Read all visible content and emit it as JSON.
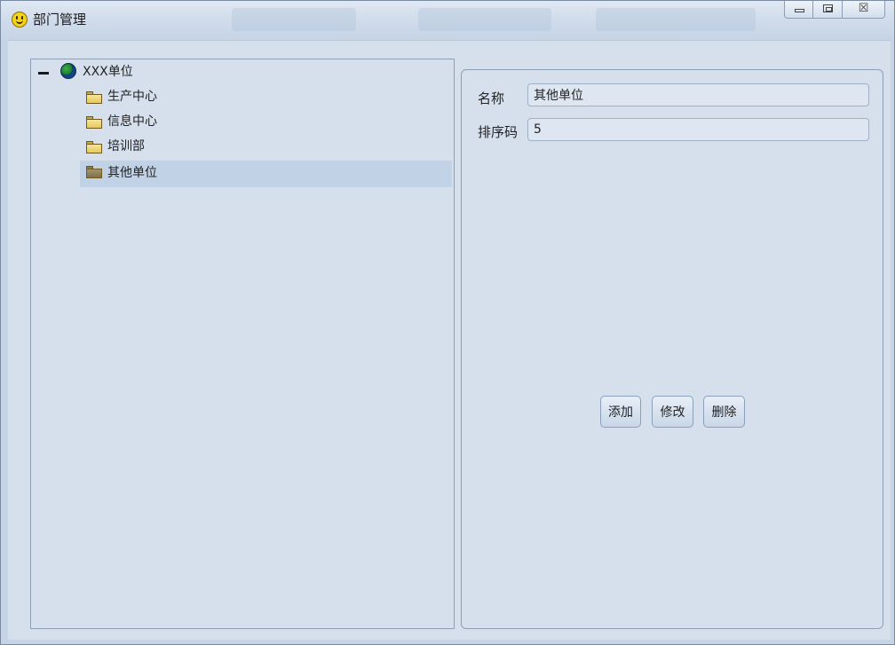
{
  "window": {
    "title": "部门管理",
    "controls": {
      "minimize_icon": "minimize-icon",
      "maximize_icon": "maximize-icon",
      "close_glyph": "☒"
    }
  },
  "tree": {
    "root": {
      "label": "XXX单位",
      "icon": "globe-icon",
      "expanded": true
    },
    "children": [
      {
        "label": "生产中心",
        "icon": "folder-icon",
        "selected": false
      },
      {
        "label": "信息中心",
        "icon": "folder-icon",
        "selected": false
      },
      {
        "label": "培训部",
        "icon": "folder-icon",
        "selected": false
      },
      {
        "label": "其他单位",
        "icon": "folder-icon",
        "selected": true
      }
    ]
  },
  "form": {
    "name_label": "名称",
    "name_value": "其他单位",
    "sort_label": "排序码",
    "sort_value": "5",
    "buttons": {
      "add": "添加",
      "edit": "修改",
      "delete": "删除"
    }
  },
  "colors": {
    "background": "#d6e0ed",
    "selection": "#c2d2e6",
    "border": "#8d9eb5"
  }
}
